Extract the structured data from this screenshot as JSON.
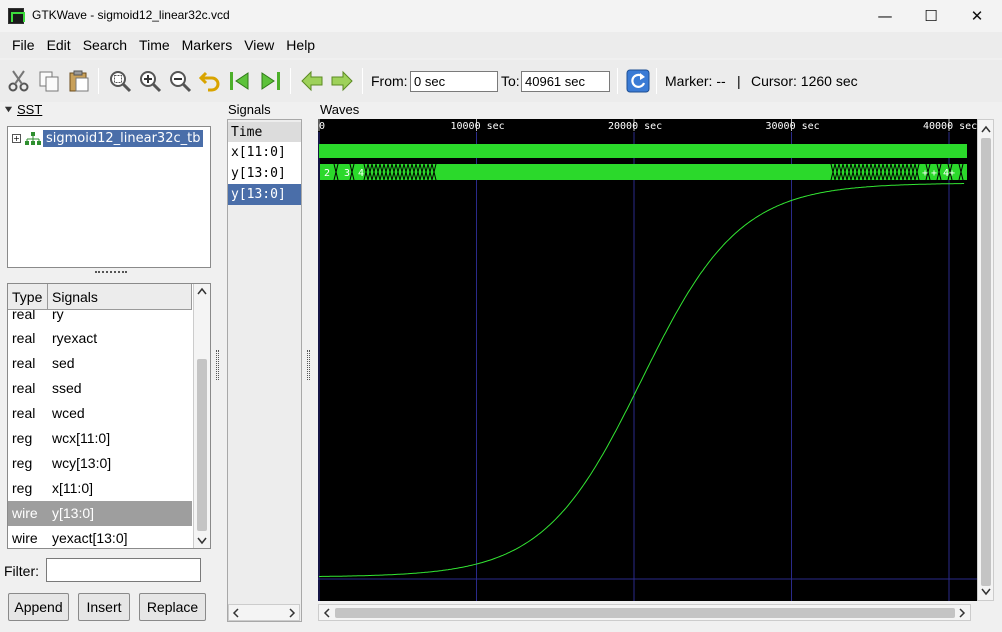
{
  "window": {
    "title": "GTKWave - sigmoid12_linear32c.vcd",
    "minimize": "—",
    "maximize": "☐",
    "close": "✕"
  },
  "menu": [
    "File",
    "Edit",
    "Search",
    "Time",
    "Markers",
    "View",
    "Help"
  ],
  "toolbar": {
    "icons": [
      "cut-icon",
      "copy-icon",
      "paste-icon",
      "zoom-fit-icon",
      "zoom-in-icon",
      "zoom-out-icon",
      "undo-icon",
      "go-start-icon",
      "go-end-icon",
      "back-icon",
      "forward-icon",
      "reload-icon"
    ],
    "from_label": "From:",
    "from_value": "0 sec",
    "to_label": "To:",
    "to_value": "40961 sec",
    "marker_label": "Marker: --",
    "separator": "|",
    "cursor_label": "Cursor: 1260 sec"
  },
  "sst": {
    "title": "SST",
    "node": "sigmoid12_linear32c_tb",
    "expander": "+"
  },
  "signals_list": {
    "headers": [
      "Type",
      "Signals"
    ],
    "rows": [
      {
        "type": "real",
        "name": "ry"
      },
      {
        "type": "real",
        "name": "ryexact"
      },
      {
        "type": "real",
        "name": "sed"
      },
      {
        "type": "real",
        "name": "ssed"
      },
      {
        "type": "real",
        "name": "wced"
      },
      {
        "type": "reg",
        "name": "wcx[11:0]"
      },
      {
        "type": "reg",
        "name": "wcy[13:0]"
      },
      {
        "type": "reg",
        "name": "x[11:0]"
      },
      {
        "type": "wire",
        "name": "y[13:0]",
        "selected": true
      },
      {
        "type": "wire",
        "name": "yexact[13:0]"
      }
    ]
  },
  "filter": {
    "label": "Filter:",
    "value": ""
  },
  "buttons": {
    "append": "Append",
    "insert": "Insert",
    "replace": "Replace"
  },
  "signals_pane": {
    "title": "Signals",
    "time_label": "Time",
    "names": [
      "x[11:0]",
      "y[13:0]",
      "y[13:0]"
    ],
    "selected_index": 2
  },
  "waves": {
    "title": "Waves",
    "time_range": [
      0,
      40961
    ],
    "tick_labels": [
      "0",
      "10000 sec",
      "20000 sec",
      "30000 sec",
      "40000 sec"
    ],
    "tick_values": [
      0,
      10000,
      20000,
      30000,
      40000
    ],
    "bus_values_left": [
      "2",
      "3",
      "4"
    ],
    "bus_values_right": [
      "+",
      "+",
      "4+"
    ],
    "wave_color": "#2bd92b",
    "grid_color": "#2a2a8a",
    "analog_color": "#33e633"
  },
  "colors": {
    "selection": "#4a6ea9",
    "row_selected": "#9e9e9e"
  }
}
